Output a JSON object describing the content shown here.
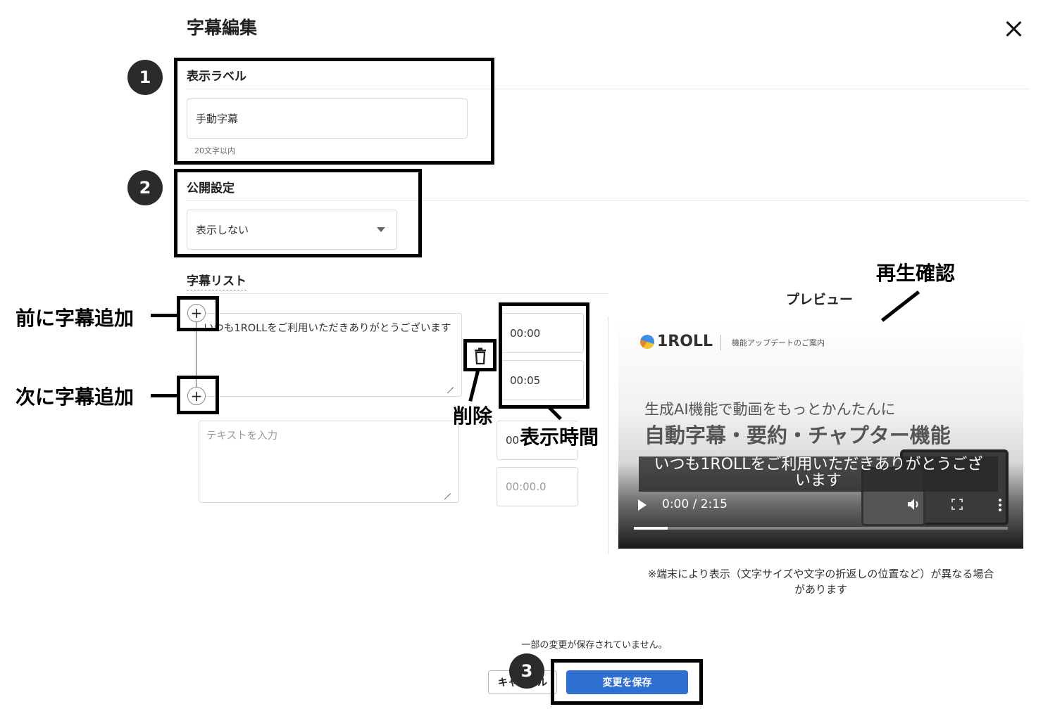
{
  "dialog": {
    "title": "字幕編集"
  },
  "label_section": {
    "heading": "表示ラベル",
    "value": "手動字幕",
    "hint": "20文字以内"
  },
  "visibility_section": {
    "heading": "公開設定",
    "selected": "表示しない"
  },
  "list_section": {
    "heading": "字幕リスト",
    "rows": [
      {
        "text": "いつも1ROLLをご利用いただきありがとうございます",
        "start": "00:00",
        "end": "00:05"
      },
      {
        "text_placeholder": "テキストを入力",
        "start": "00:",
        "end_placeholder": "00:00.0"
      }
    ]
  },
  "preview": {
    "label": "プレビュー",
    "brand": "1ROLL",
    "brand_sub": "機能アップデートのご案内",
    "headline_small": "生成AI機能で動画をもっとかんたんに",
    "headline_large": "自動字幕・要約・チャプター機能",
    "caption": "いつも1ROLLをご利用いただきありがとうござ\nいます",
    "time": "0:00 / 2:15",
    "progress": 0.09,
    "note": "※端末により表示（文字サイズや文字の折返しの位置など）が異なる場合\nがあります"
  },
  "footer": {
    "unsaved_notice": "一部の変更が保存されていません。",
    "cancel_label": "キャンセル",
    "save_label": "変更を保存"
  },
  "annotations": {
    "badge1": "1",
    "badge2": "2",
    "badge3": "3",
    "add_before": "前に字幕追加",
    "add_after": "次に字幕追加",
    "delete": "削除",
    "display_time": "表示時間",
    "playback": "再生確認"
  },
  "colors": {
    "primary": "#2f6fd0",
    "annotation": "#000000",
    "badge": "#2b2b2b"
  },
  "icons": {
    "close": "close-icon",
    "add": "plus-icon",
    "delete": "trash-icon",
    "dropdown": "chevron-down-icon",
    "play": "play-icon",
    "volume": "volume-icon",
    "fullscreen": "fullscreen-icon",
    "more": "more-vertical-icon"
  }
}
